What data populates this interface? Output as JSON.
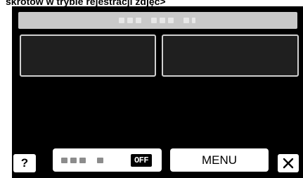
{
  "caption": "skrótów w trybie rejestracji zdjęć>",
  "help_button": {
    "label": "?"
  },
  "toggle_button": {
    "state": "OFF"
  },
  "menu_button": {
    "label": "MENU"
  },
  "close_button": {
    "icon": "close-icon"
  },
  "colors": {
    "screen_bg": "#000000",
    "title_bar": "#c9c9c9",
    "button_bg": "#ffffff",
    "panel_border": "#cfcfcf"
  }
}
